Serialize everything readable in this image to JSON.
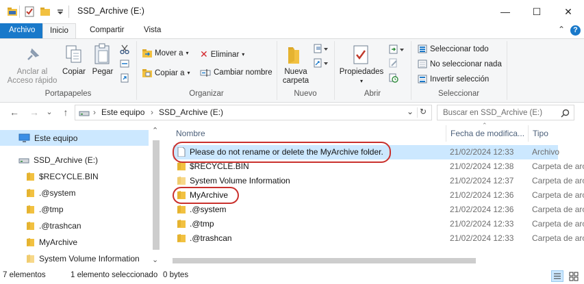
{
  "window": {
    "title": "SSD_Archive (E:)",
    "minimize": "—",
    "maximize": "☐",
    "close": "✕"
  },
  "tabs": {
    "file": "Archivo",
    "home": "Inicio",
    "share": "Compartir",
    "view": "Vista",
    "collapse": "⌃",
    "help": "?"
  },
  "ribbon": {
    "clipboard": {
      "group": "Portapapeles",
      "pin_line1": "Anclar al",
      "pin_line2": "Acceso rápido",
      "copy": "Copiar",
      "paste": "Pegar"
    },
    "organize": {
      "group": "Organizar",
      "move_to": "Mover a",
      "copy_to": "Copiar a",
      "delete": "Eliminar",
      "rename": "Cambiar nombre"
    },
    "new": {
      "group": "Nuevo",
      "new_folder_line1": "Nueva",
      "new_folder_line2": "carpeta"
    },
    "open": {
      "group": "Abrir",
      "properties": "Propiedades"
    },
    "select": {
      "group": "Seleccionar",
      "select_all": "Seleccionar todo",
      "select_none": "No seleccionar nada",
      "invert": "Invertir selección"
    }
  },
  "address": {
    "back": "←",
    "forward": "→",
    "recent": "⌄",
    "up": "↑",
    "sep1": "›",
    "this_pc": "Este equipo",
    "sep2": "›",
    "drive": "SSD_Archive (E:)",
    "dropdown": "⌄",
    "refresh": "↻",
    "search_placeholder": "Buscar en SSD_Archive (E:)"
  },
  "navpane": {
    "items": [
      {
        "label": "Este equipo"
      },
      {
        "label": "SSD_Archive (E:)"
      },
      {
        "label": "$RECYCLE.BIN"
      },
      {
        "label": ".@system"
      },
      {
        "label": ".@tmp"
      },
      {
        "label": ".@trashcan"
      },
      {
        "label": "MyArchive"
      },
      {
        "label": "System Volume Information"
      }
    ],
    "scroll_up": "⌃",
    "scroll_down": "⌄"
  },
  "columns": {
    "name": "Nombre",
    "date": "Fecha de modifica...",
    "type": "Tipo",
    "sort_arrow": "⌃"
  },
  "files": [
    {
      "name": "Please do not rename or delete the MyArchive folder.",
      "date": "21/02/2024 12:33",
      "type": "Archivo",
      "icon": "document-icon"
    },
    {
      "name": "$RECYCLE.BIN",
      "date": "21/02/2024 12:38",
      "type": "Carpeta de archivos",
      "icon": "folder-icon"
    },
    {
      "name": "System Volume Information",
      "date": "21/02/2024 12:37",
      "type": "Carpeta de archivos",
      "icon": "folder-icon"
    },
    {
      "name": "MyArchive",
      "date": "21/02/2024 12:36",
      "type": "Carpeta de archivos",
      "icon": "folder-icon"
    },
    {
      "name": ".@system",
      "date": "21/02/2024 12:36",
      "type": "Carpeta de archivos",
      "icon": "folder-icon"
    },
    {
      "name": ".@tmp",
      "date": "21/02/2024 12:33",
      "type": "Carpeta de archivos",
      "icon": "folder-icon"
    },
    {
      "name": ".@trashcan",
      "date": "21/02/2024 12:33",
      "type": "Carpeta de archivos",
      "icon": "folder-icon"
    }
  ],
  "status": {
    "count": "7 elementos",
    "selected": "1 elemento seleccionado",
    "size": "0 bytes"
  },
  "colors": {
    "accent": "#1979ca",
    "selection": "#cce8ff",
    "highlight": "#c9302c",
    "folder": "#f5c542"
  }
}
